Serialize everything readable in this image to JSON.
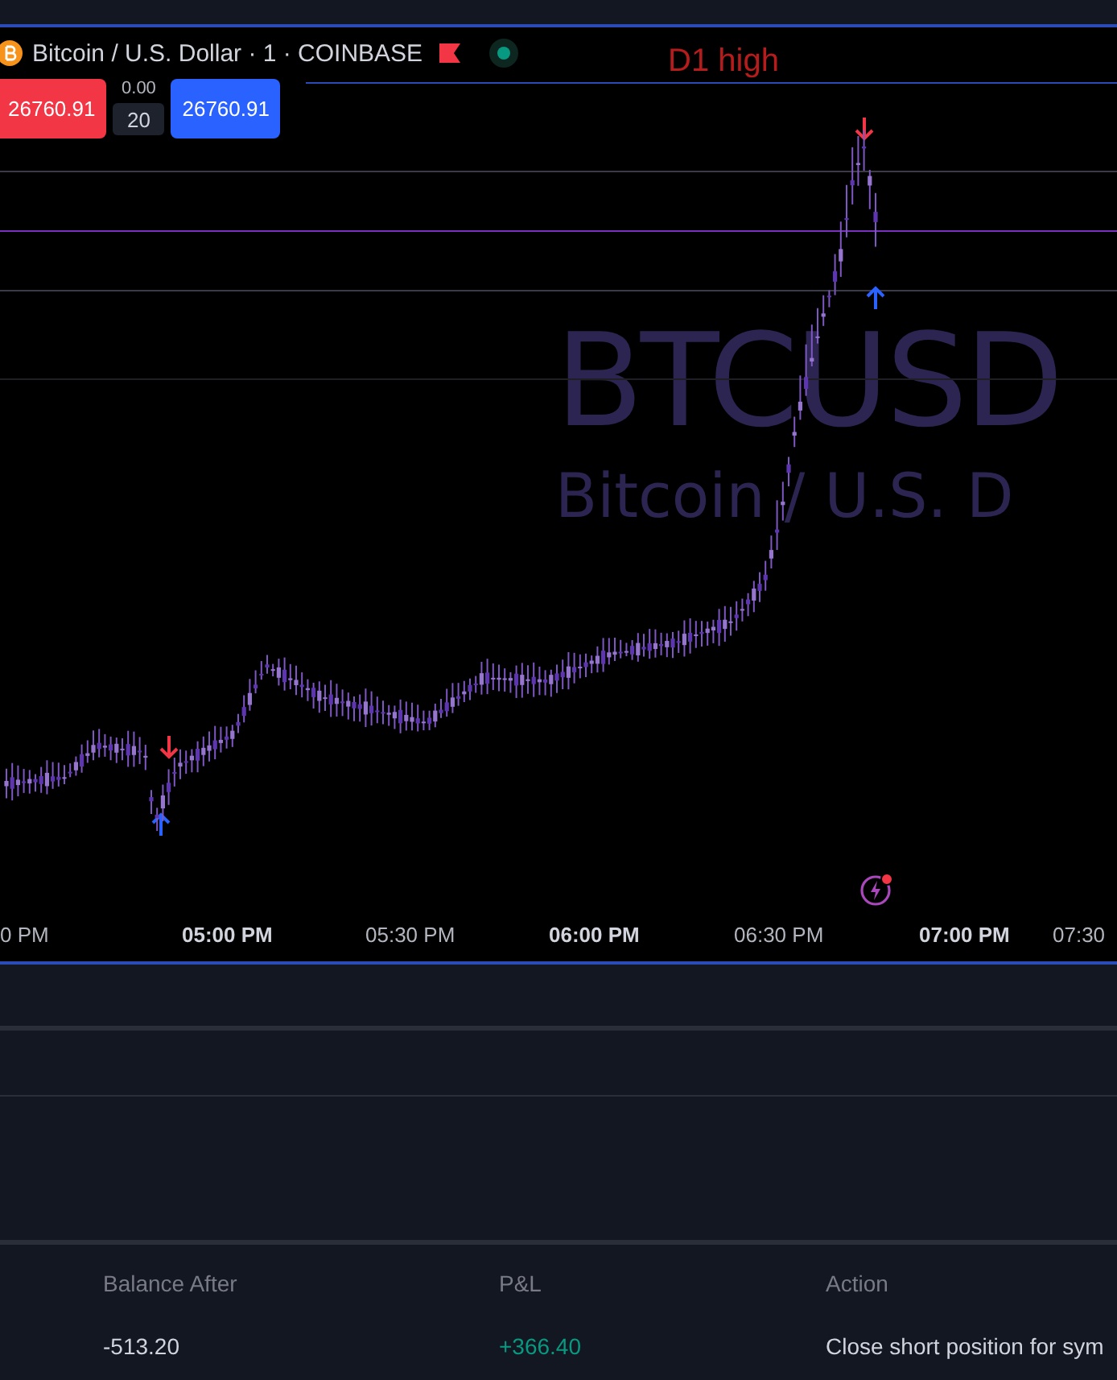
{
  "legend": {
    "symbol": "Bitcoin / U.S. Dollar · 1 · COINBASE",
    "market_open": true
  },
  "order_panel": {
    "sell_price": "26760.91",
    "spread": "0.00",
    "quantity": "20",
    "buy_price": "26760.91"
  },
  "level_label": "D1 high",
  "watermark": {
    "ticker": "BTCUSD",
    "description": "Bitcoin / U.S. D"
  },
  "signals": [
    {
      "kind": "sell",
      "color": "#f23645"
    },
    {
      "kind": "buy",
      "color": "#2962ff"
    },
    {
      "kind": "sell",
      "color": "#f23645"
    },
    {
      "kind": "buy",
      "color": "#2962ff"
    }
  ],
  "time_axis": [
    {
      "label": "0 PM",
      "bold": false
    },
    {
      "label": "05:00 PM",
      "bold": true
    },
    {
      "label": "05:30 PM",
      "bold": false
    },
    {
      "label": "06:00 PM",
      "bold": true
    },
    {
      "label": "06:30 PM",
      "bold": false
    },
    {
      "label": "07:00 PM",
      "bold": true
    },
    {
      "label": "07:30",
      "bold": false
    }
  ],
  "table": {
    "columns": [
      "Balance After",
      "P&L",
      "Action"
    ],
    "rows": [
      {
        "balance_after": "-513.20",
        "pnl": "+366.40",
        "pnl_positive": true,
        "action": "Close short position for sym"
      }
    ]
  }
}
